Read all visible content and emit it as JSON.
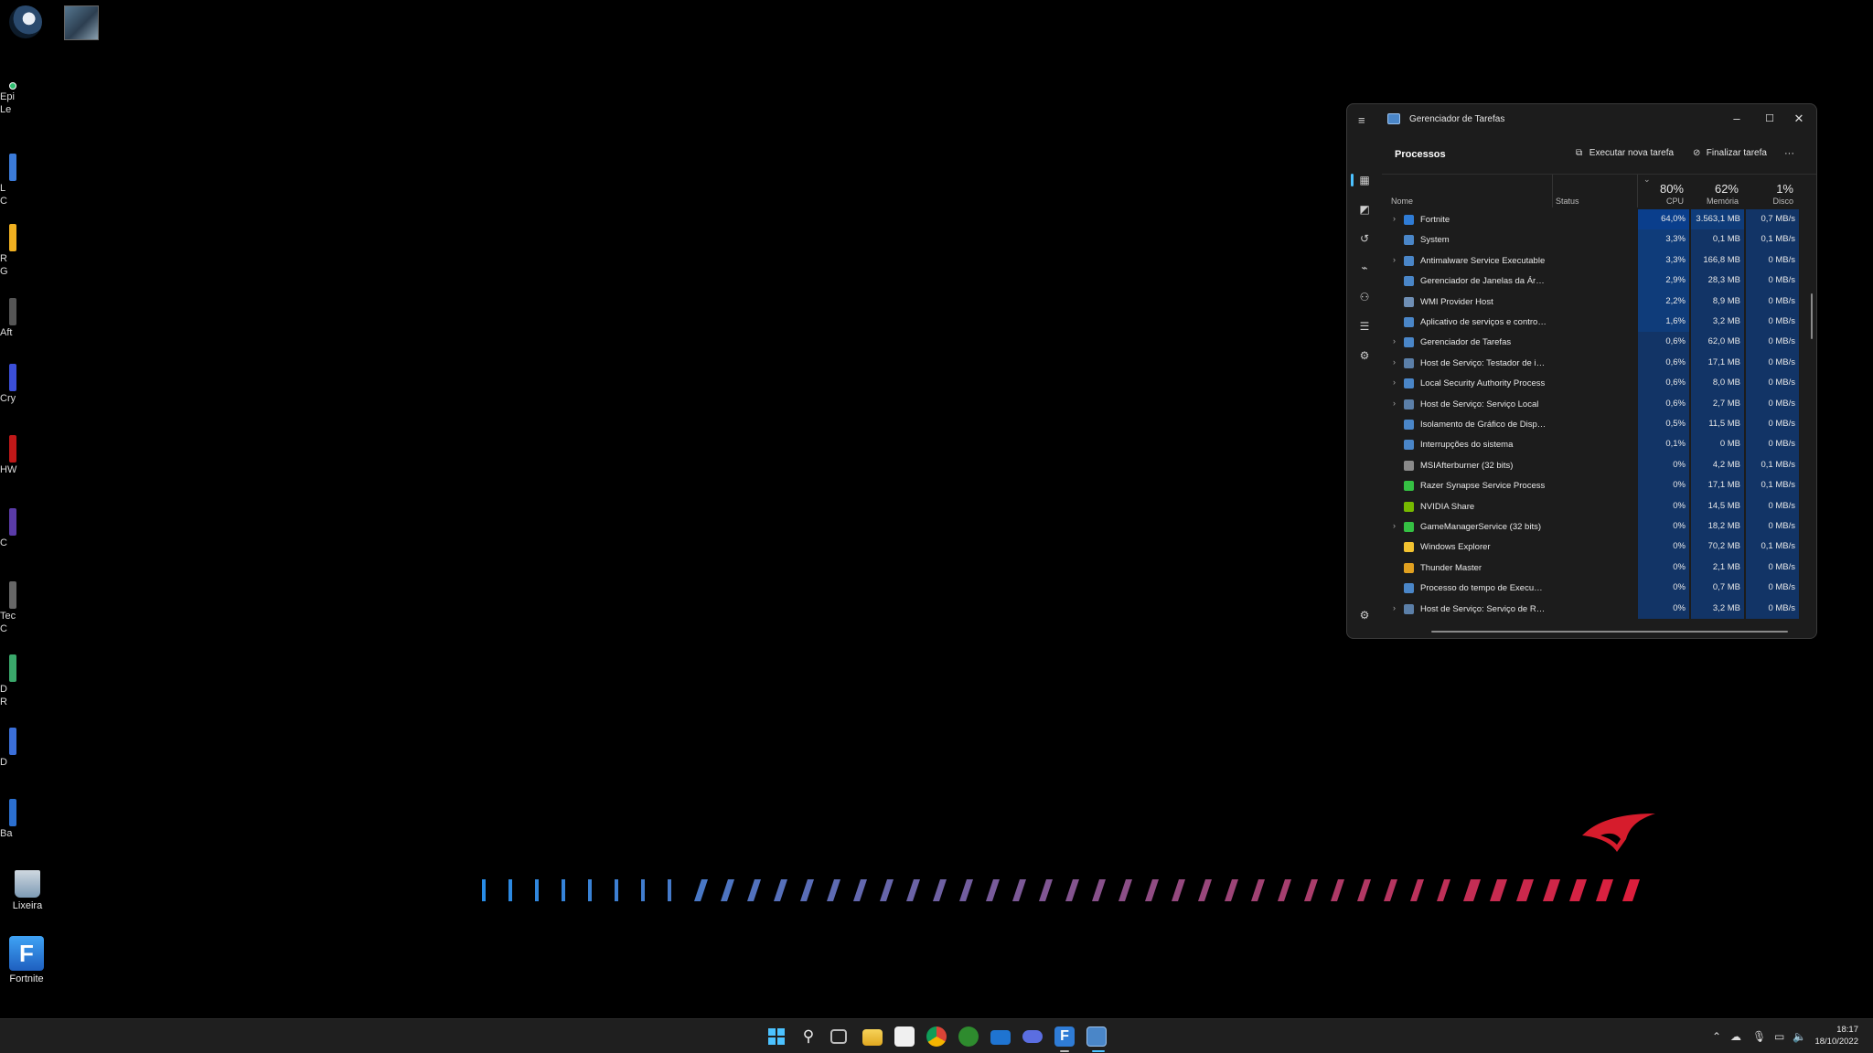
{
  "desktop": {
    "icons": [
      {
        "label": "Lixeira"
      },
      {
        "label": "Fortnite"
      }
    ],
    "partial_labels": [
      "Epi",
      "Le",
      "L",
      "C",
      "R",
      "G",
      "Aft",
      "Cry",
      "HW",
      "C",
      "Tec",
      "C",
      "D",
      "R",
      "D",
      "Ba"
    ]
  },
  "taskmanager": {
    "title": "Gerenciador de Tarefas",
    "window_buttons": {
      "minimize": "–",
      "maximize": "☐",
      "close": "✕"
    },
    "page_title": "Processos",
    "run_new_task": "Executar nova tarefa",
    "end_task": "Finalizar tarefa",
    "more": "···",
    "columns": {
      "name": "Nome",
      "status": "Status",
      "cpu": {
        "pct": "80%",
        "label": "CPU"
      },
      "memory": {
        "pct": "62%",
        "label": "Memória"
      },
      "disk": {
        "pct": "1%",
        "label": "Disco"
      }
    },
    "processes": [
      {
        "name": "Fortnite",
        "cpu": "64,0%",
        "mem": "3.563,1 MB",
        "disk": "0,7 MB/s",
        "expand": true,
        "icon": "fortnite-icon",
        "color": "#2f7cd6"
      },
      {
        "name": "System",
        "cpu": "3,3%",
        "mem": "0,1 MB",
        "disk": "0,1 MB/s",
        "expand": false,
        "icon": "system-icon",
        "color": "#4a86c8"
      },
      {
        "name": "Antimalware Service Executable",
        "cpu": "3,3%",
        "mem": "166,8 MB",
        "disk": "0 MB/s",
        "expand": true,
        "icon": "service-icon",
        "color": "#4a86c8"
      },
      {
        "name": "Gerenciador de Janelas da Área de Trabalho",
        "cpu": "2,9%",
        "mem": "28,3 MB",
        "disk": "0 MB/s",
        "expand": false,
        "icon": "window-manager-icon",
        "color": "#4a86c8"
      },
      {
        "name": "WMI Provider Host",
        "cpu": "2,2%",
        "mem": "8,9 MB",
        "disk": "0 MB/s",
        "expand": false,
        "icon": "wmi-icon",
        "color": "#6f8fb5"
      },
      {
        "name": "Aplicativo de serviços e controladores",
        "cpu": "1,6%",
        "mem": "3,2 MB",
        "disk": "0 MB/s",
        "expand": false,
        "icon": "service-icon",
        "color": "#4a86c8"
      },
      {
        "name": "Gerenciador de Tarefas",
        "cpu": "0,6%",
        "mem": "62,0 MB",
        "disk": "0 MB/s",
        "expand": true,
        "icon": "taskmanager-icon",
        "color": "#4a86c8"
      },
      {
        "name": "Host de Serviço: Testador de integridade",
        "cpu": "0,6%",
        "mem": "17,1 MB",
        "disk": "0 MB/s",
        "expand": true,
        "icon": "gear-icon",
        "color": "#5b7fa8"
      },
      {
        "name": "Local Security Authority Process",
        "cpu": "0,6%",
        "mem": "8,0 MB",
        "disk": "0 MB/s",
        "expand": true,
        "icon": "service-icon",
        "color": "#4a86c8"
      },
      {
        "name": "Host de Serviço: Serviço Local",
        "cpu": "0,6%",
        "mem": "2,7 MB",
        "disk": "0 MB/s",
        "expand": true,
        "icon": "gear-icon",
        "color": "#5b7fa8"
      },
      {
        "name": "Isolamento de Gráfico de Dispositivo",
        "cpu": "0,5%",
        "mem": "11,5 MB",
        "disk": "0 MB/s",
        "expand": false,
        "icon": "service-icon",
        "color": "#4a86c8"
      },
      {
        "name": "Interrupções do sistema",
        "cpu": "0,1%",
        "mem": "0 MB",
        "disk": "0 MB/s",
        "expand": false,
        "icon": "service-icon",
        "color": "#4a86c8"
      },
      {
        "name": "MSIAfterburner (32 bits)",
        "cpu": "0%",
        "mem": "4,2 MB",
        "disk": "0,1 MB/s",
        "expand": false,
        "icon": "afterburner-icon",
        "color": "#8a8a8a"
      },
      {
        "name": "Razer Synapse Service Process",
        "cpu": "0%",
        "mem": "17,1 MB",
        "disk": "0,1 MB/s",
        "expand": false,
        "icon": "razer-icon",
        "color": "#35c043"
      },
      {
        "name": "NVIDIA Share",
        "cpu": "0%",
        "mem": "14,5 MB",
        "disk": "0 MB/s",
        "expand": false,
        "icon": "nvidia-icon",
        "color": "#76b900"
      },
      {
        "name": "GameManagerService (32 bits)",
        "cpu": "0%",
        "mem": "18,2 MB",
        "disk": "0 MB/s",
        "expand": true,
        "icon": "gamemanager-icon",
        "color": "#35c043"
      },
      {
        "name": "Windows Explorer",
        "cpu": "0%",
        "mem": "70,2 MB",
        "disk": "0,1 MB/s",
        "expand": false,
        "icon": "folder-icon",
        "color": "#f2c230"
      },
      {
        "name": "Thunder Master",
        "cpu": "0%",
        "mem": "2,1 MB",
        "disk": "0 MB/s",
        "expand": false,
        "icon": "thunder-icon",
        "color": "#e0a020"
      },
      {
        "name": "Processo do tempo de Execução do Cliente-Servidor",
        "cpu": "0%",
        "mem": "0,7 MB",
        "disk": "0 MB/s",
        "expand": false,
        "icon": "service-icon",
        "color": "#4a86c8"
      },
      {
        "name": "Host de Serviço: Serviço de Rede",
        "cpu": "0%",
        "mem": "3,2 MB",
        "disk": "0 MB/s",
        "expand": true,
        "icon": "gear-icon",
        "color": "#5b7fa8"
      }
    ]
  },
  "taskbar": {
    "time": "18:17",
    "date": "18/10/2022"
  },
  "colors": {
    "cpu_high": "#0a3e8c",
    "cpu_mid": "#0f3c7a",
    "cpu_low": "#123466",
    "accent": "#4cc2ff"
  }
}
